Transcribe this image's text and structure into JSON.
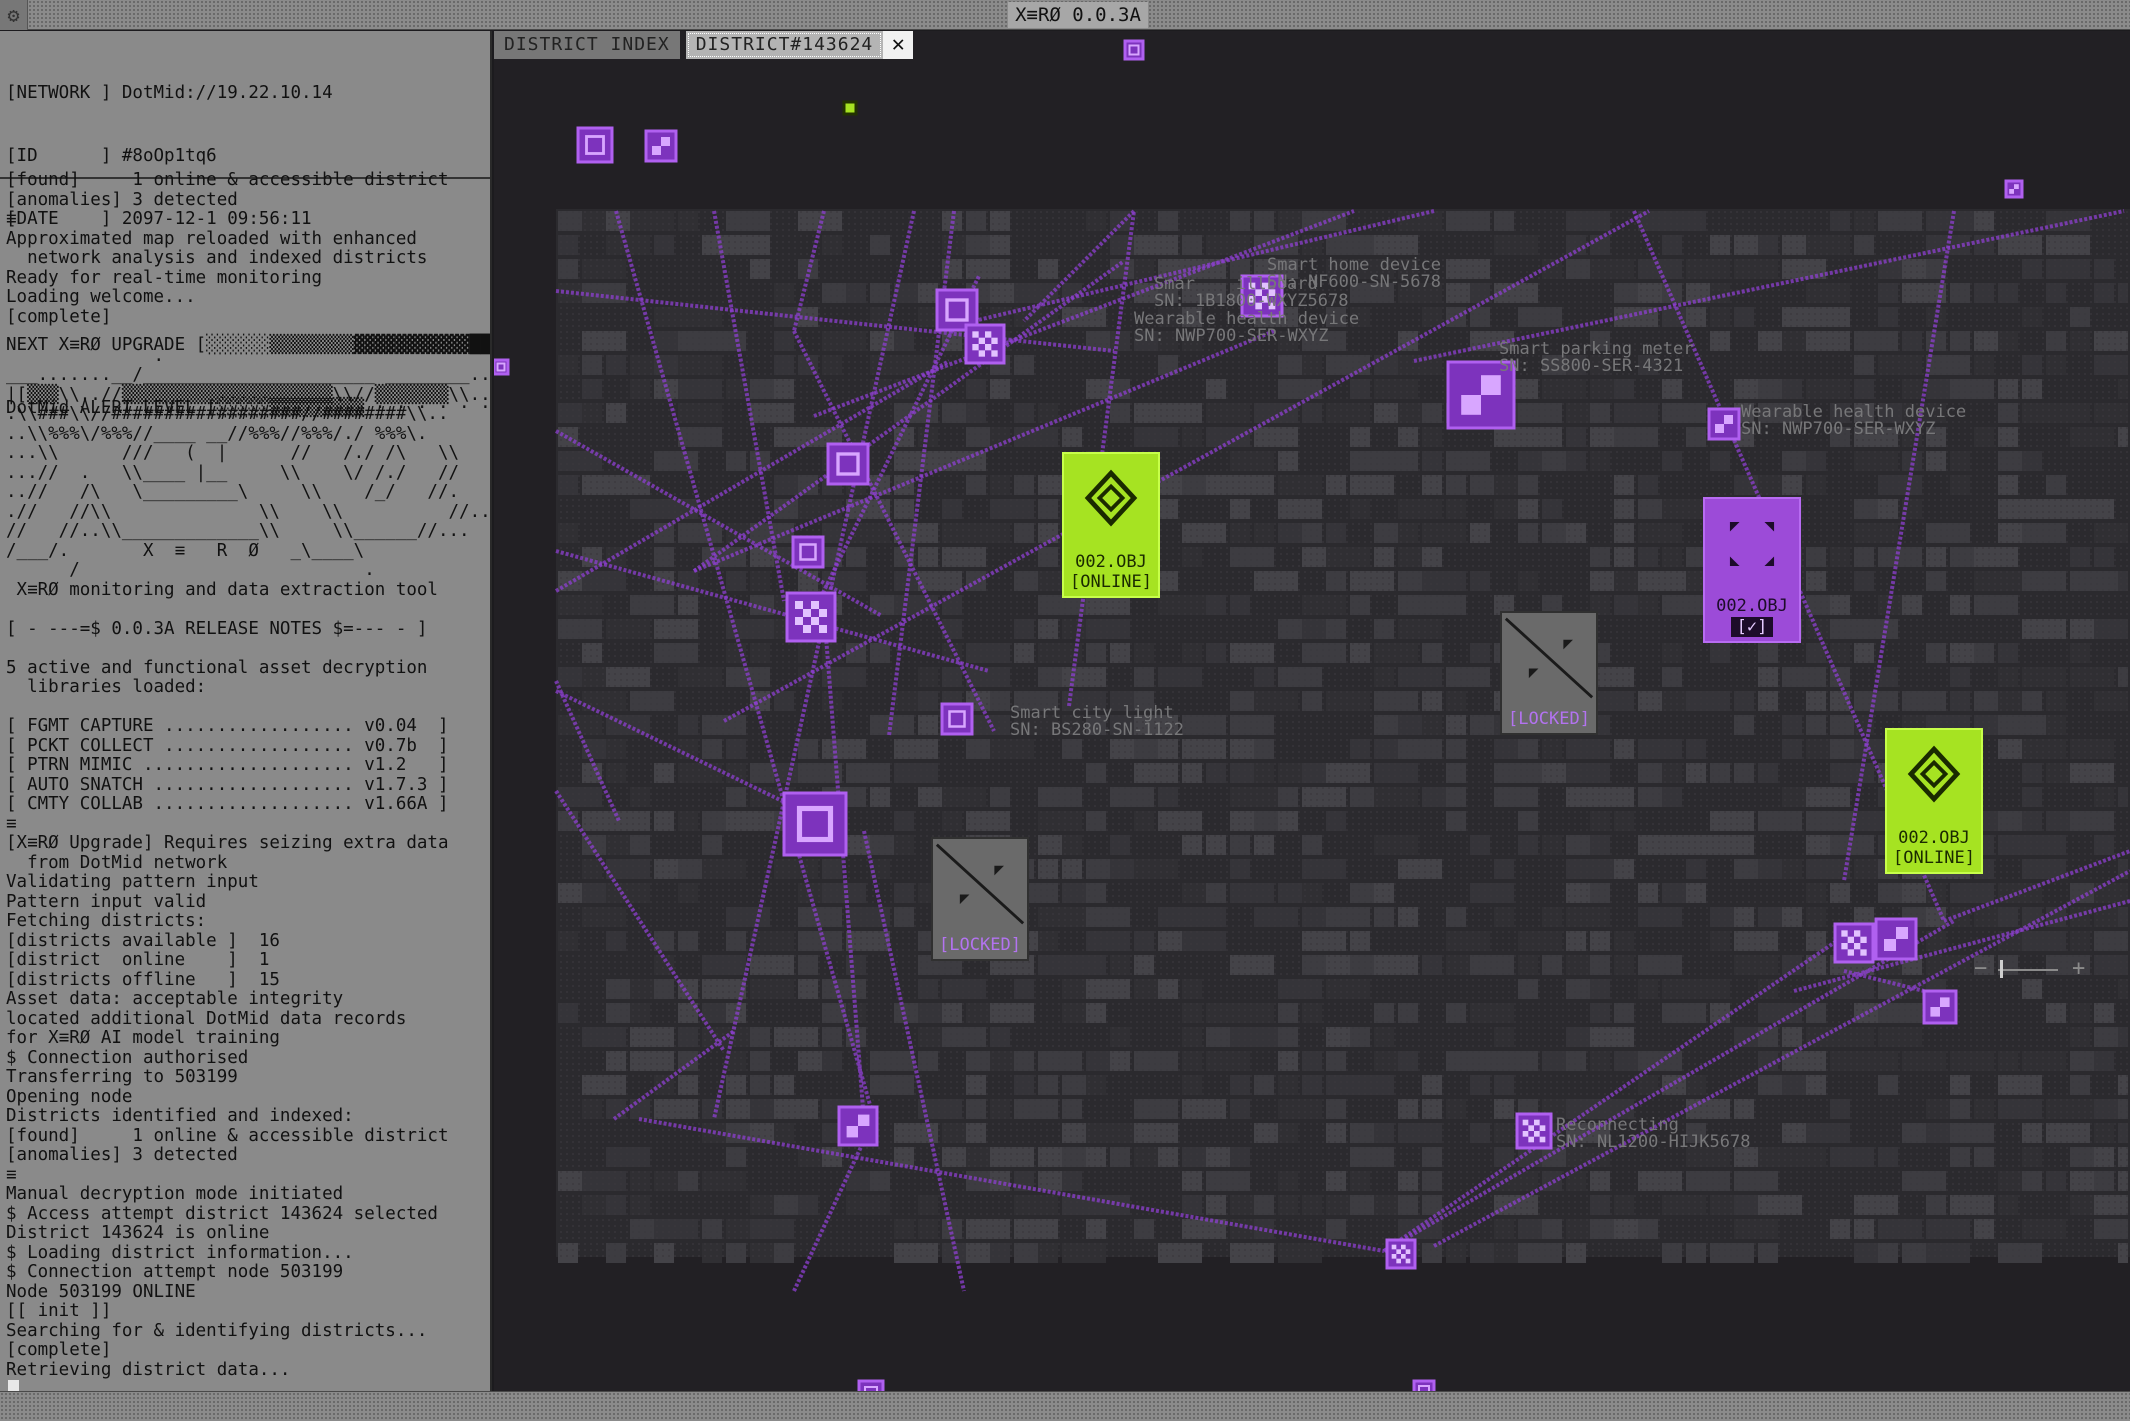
{
  "window": {
    "title": "X≡RØ 0.0.3A",
    "settings_icon": "gear-icon"
  },
  "console": {
    "network": "[NETWORK ] DotMid://19.22.10.14",
    "id": "[ID      ] #8oOp1tq6",
    "date": "[DATE    ] 2097-12-1 09:56:11",
    "upgrade": "NEXT X≡RØ UPGRADE [░░░░░░▒▒▒▒▒▒▒▒▓▓▓▓▓▓▓▓▓▓▓███████ ·]",
    "alert": "DotMid ALERT LEVEL [░░░░░▒▒▒▒▒▒▒▒▒ · · · · · · ·]",
    "log": [
      "[found]     1 online & accessible district",
      "[anomalies] 3 detected",
      "≡",
      "Approximated map reloaded with enhanced",
      "  network analysis and indexed districts",
      "Ready for real-time monitoring",
      "Loading welcome...",
      "[complete]",
      "",
      "              .",
      "___.......__/______________________ ________.....",
      "|[▒▒▒\\\\..//▒▒▒▒▒▒▒▒▒▒▒▒▒▒▒▒▒▒▒▒\\\\//▒▒▒▒▒▒▒\\\\..",
      ".\\\\###\\\\//##################//########\\\\..",
      "..\\\\%%%\\/%%%//____ __//%%%//%%%/./ %%%\\.",
      "...\\\\      ///   (  |      //   /./ /\\   \\\\",
      "...//  .   \\\\____ |__     \\\\    \\/ /./   //",
      "..//   /\\   \\_________\\     \\\\    /_/   //.",
      ".//   //\\\\              \\\\    \\\\          //..",
      "//   //..\\\\_____________\\\\     \\\\______//...",
      "/___/.       X  ≡   R  Ø   _\\____\\",
      "      /                           .",
      " X≡RØ monitoring and data extraction tool",
      "",
      "[ - ---=$ 0.0.3A RELEASE NOTES $=--- - ]",
      "",
      "5 active and functional asset decryption",
      "  libraries loaded:",
      "",
      "[ FGMT CAPTURE .................. v0.04  ]",
      "[ PCKT COLLECT .................. v0.7b  ]",
      "[ PTRN MIMIC .................... v1.2   ]",
      "[ AUTO SNATCH ................... v1.7.3 ]",
      "[ CMTY COLLAB ................... v1.66A ]",
      "≡",
      "[X≡RØ Upgrade] Requires seizing extra data",
      "  from DotMid network",
      "Validating pattern input",
      "Pattern input valid",
      "Fetching districts:",
      "[districts available ]  16",
      "[district  online    ]  1",
      "[districts offline   ]  15",
      "Asset data: acceptable integrity",
      "located additional DotMid data records",
      "for X≡RØ AI model training",
      "$ Connection authorised",
      "Transferring to 503199",
      "Opening node",
      "Districts identified and indexed:",
      "[found]     1 online & accessible district",
      "[anomalies] 3 detected",
      "≡",
      "Manual decryption mode initiated",
      "$ Access attempt district 143624 selected",
      "District 143624 is online",
      "$ Loading district information...",
      "$ Connection attempt node 503199",
      "Node 503199 ONLINE",
      "[[ init ]]",
      "Searching for & identifying districts...",
      "[complete]",
      "Retrieving district data..."
    ]
  },
  "tabs": [
    {
      "label": "DISTRICT INDEX",
      "active": false
    },
    {
      "label": "DISTRICT#143624",
      "active": true
    }
  ],
  "tab_close": "✕",
  "map": {
    "devices": [
      {
        "name": "Smart home device",
        "sn": "SN: NF600-SN-5678"
      },
      {
        "name": "Smar    illboard",
        "sn": "SN: 1B1800-WXYZ5678"
      },
      {
        "name": "Wearable health device",
        "sn": "SN: NWP700-SER-WXYZ"
      },
      {
        "name": "Smart parking meter",
        "sn": "SN: SS800-SER-4321"
      },
      {
        "name": "Wearable health device",
        "sn": "SN: NWP700-SER-WXYZ"
      },
      {
        "name": "Smart city light",
        "sn": "SN: BS280-SN-1122"
      },
      {
        "name": "Reconnecting",
        "sn": "SN: NL1200-HIJK5678"
      }
    ],
    "cards": [
      {
        "kind": "online",
        "obj": "002.OBJ",
        "status": "[ONLINE]",
        "icon": "diamond-target-icon"
      },
      {
        "kind": "selected",
        "obj": "002.OBJ",
        "status": "[✓]",
        "icon": "expand-arrows-icon"
      },
      {
        "kind": "locked",
        "status": "[LOCKED]",
        "icon": "locked-slash-icon"
      },
      {
        "kind": "locked",
        "status": "[LOCKED]",
        "icon": "locked-slash-icon"
      },
      {
        "kind": "online",
        "obj": "002.OBJ",
        "status": "[ONLINE]",
        "icon": "diamond-target-icon"
      }
    ],
    "zoom": {
      "minus": "−",
      "plus": "+",
      "level": 0.1
    },
    "colors": {
      "node": "#9b4bd6",
      "online": "#a6e322",
      "locked": "#6a6a6a",
      "link": "#8d3fd0"
    }
  }
}
